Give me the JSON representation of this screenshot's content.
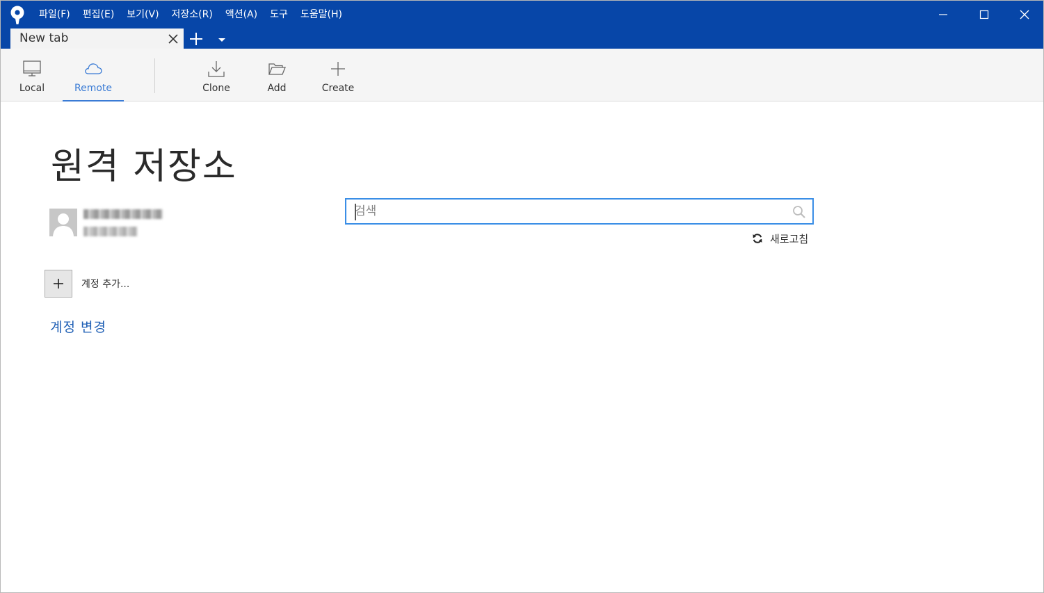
{
  "app": {
    "logo_icon": "sourcetree-logo-icon",
    "accent_color": "#0746a8"
  },
  "menu": [
    {
      "label": "파일(F)"
    },
    {
      "label": "편집(E)"
    },
    {
      "label": "보기(V)"
    },
    {
      "label": "저장소(R)"
    },
    {
      "label": "액션(A)"
    },
    {
      "label": "도구"
    },
    {
      "label": "도움말(H)"
    }
  ],
  "window_controls": {
    "minimize_icon": "minimize-icon",
    "maximize_icon": "maximize-icon",
    "close_icon": "close-icon"
  },
  "tabs": [
    {
      "label": "New tab",
      "active": true
    }
  ],
  "toolbar": {
    "items": [
      {
        "label": "Local",
        "icon": "monitor-icon",
        "selected": false
      },
      {
        "label": "Remote",
        "icon": "cloud-icon",
        "selected": true
      },
      {
        "label": "Clone",
        "icon": "download-icon",
        "selected": false
      },
      {
        "label": "Add",
        "icon": "folder-open-icon",
        "selected": false
      },
      {
        "label": "Create",
        "icon": "plus-icon",
        "selected": false
      }
    ]
  },
  "main": {
    "title": "원격 저장소",
    "account": {
      "avatar_icon": "user-avatar-icon",
      "username_redacted": true,
      "host_redacted": true
    },
    "add_account_label": "계정 추가...",
    "change_account_label": "계정 변경",
    "search": {
      "placeholder": "검색",
      "value": ""
    },
    "refresh_label": "새로고침"
  }
}
